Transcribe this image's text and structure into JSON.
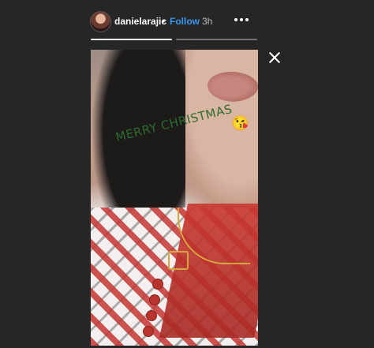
{
  "header": {
    "username": "danielarajic",
    "separator": "•",
    "follow_label": "Follow",
    "time_ago": "3h",
    "more_icon": "more-horizontal-icon"
  },
  "story": {
    "caption": "MERRY CHRISTMAS",
    "emoji": "😘",
    "progress": {
      "segments": 2,
      "current_index": 0
    }
  },
  "controls": {
    "close_icon": "close-icon"
  },
  "colors": {
    "background": "#262626",
    "follow": "#3897f0",
    "caption": "#2e6b2e"
  }
}
